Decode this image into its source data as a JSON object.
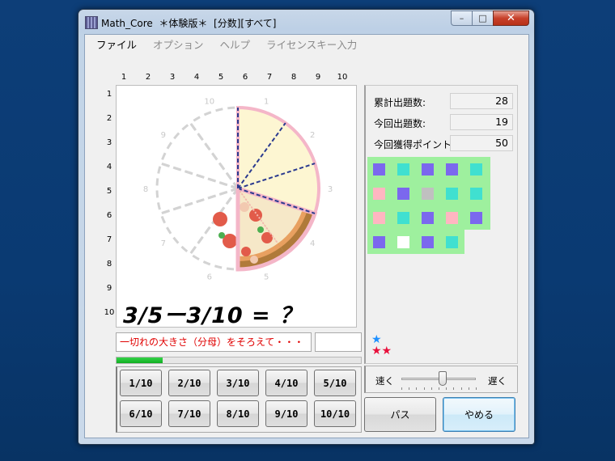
{
  "window": {
    "title": "Math_Core  ＊体験版＊  [分数][すべて]"
  },
  "caption_buttons": {
    "minimize": "–",
    "maximize": "□",
    "close": "✕"
  },
  "menu": [
    "ファイル",
    "オプション",
    "ヘルプ",
    "ライセンスキー入力"
  ],
  "grid": {
    "columns": [
      "1",
      "2",
      "3",
      "4",
      "5",
      "6",
      "7",
      "8",
      "9",
      "10"
    ],
    "rows": [
      "1",
      "2",
      "3",
      "4",
      "5",
      "6",
      "7",
      "8",
      "9",
      "10"
    ]
  },
  "pizza": {
    "slice_labels": [
      "1",
      "2",
      "3",
      "4",
      "5",
      "6",
      "7",
      "8",
      "9",
      "10"
    ],
    "total_slices": 10,
    "highlighted_slices": 3,
    "pizza_slices": 2,
    "colors": {
      "highlight_fill": "#fdf6d2",
      "highlight_border": "#f4b6c8",
      "divider": "#2a3a8f",
      "empty_outline": "#d3d3d3",
      "crust": "#b07a3a",
      "sauce": "#e8a060"
    }
  },
  "problem": {
    "text": "3/5ー3/10 = ？"
  },
  "hint": {
    "text": "一切れの大きさ（分母）をそろえて・・・"
  },
  "progress": {
    "fraction": 0.19
  },
  "answers": [
    "1/10",
    "2/10",
    "3/10",
    "4/10",
    "5/10",
    "6/10",
    "7/10",
    "8/10",
    "9/10",
    "10/10"
  ],
  "stats": [
    {
      "label": "累計出題数:",
      "value": "28"
    },
    {
      "label": "今回出題数:",
      "value": "19"
    },
    {
      "label": "今回獲得ポイント:",
      "value": "50"
    }
  ],
  "result_grid": {
    "background": "#9ef09e",
    "cells": [
      "purple",
      "teal",
      "purple",
      "purple",
      "teal",
      "pink",
      "purple",
      "gray",
      "teal",
      "teal",
      "pink",
      "teal",
      "purple",
      "pink",
      "purple",
      "purple",
      "white",
      "purple",
      "teal"
    ],
    "colors": {
      "purple": "#7b68ee",
      "teal": "#40e0d0",
      "pink": "#ffb6c1",
      "gray": "#c0c0c0",
      "white": "#ffffff"
    }
  },
  "stars": [
    {
      "glyph": "★★",
      "color": "#e8103c"
    }
  ],
  "star_blue": {
    "glyph": "★",
    "color": "#1e90ff"
  },
  "speed": {
    "fast_label": "速く",
    "slow_label": "遅く",
    "level": 0.55
  },
  "buttons": {
    "pass": "パス",
    "quit": "やめる"
  }
}
